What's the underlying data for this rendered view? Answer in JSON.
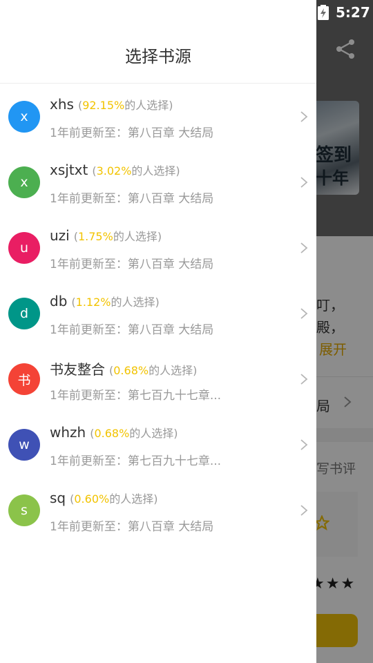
{
  "status_bar": {
    "time": "5:27",
    "battery_icon": "battery-charging-icon"
  },
  "background": {
    "share_icon": "share-icon",
    "cover_text_1": "签到",
    "cover_text_2": "十年",
    "intro_line_1": "叮，",
    "intro_line_2": "殿，",
    "expand_label": "展开",
    "row_label": "局",
    "review_label": "写书评",
    "accent_color": "#f0c20a"
  },
  "drawer": {
    "title": "选择书源",
    "sources": [
      {
        "avatar": "x",
        "color": "#2196f3",
        "name": "xhs",
        "percent": "92.15%",
        "suffix": "的人选择)",
        "prefix": "(",
        "update": "1年前更新至：第八百章 大结局"
      },
      {
        "avatar": "x",
        "color": "#4caf50",
        "name": "xsjtxt",
        "percent": "3.02%",
        "suffix": "的人选择)",
        "prefix": "(",
        "update": "1年前更新至：第八百章 大结局"
      },
      {
        "avatar": "u",
        "color": "#e91e63",
        "name": "uzi",
        "percent": "1.75%",
        "suffix": "的人选择)",
        "prefix": "(",
        "update": "1年前更新至：第八百章 大结局"
      },
      {
        "avatar": "d",
        "color": "#009688",
        "name": "db",
        "percent": "1.12%",
        "suffix": "的人选择)",
        "prefix": "(",
        "update": "1年前更新至：第八百章 大结局"
      },
      {
        "avatar": "书",
        "color": "#f44336",
        "name": "书友整合",
        "percent": "0.68%",
        "suffix": "的人选择)",
        "prefix": "(",
        "update": "1年前更新至：第七百九十七章..."
      },
      {
        "avatar": "w",
        "color": "#3f51b5",
        "name": "whzh",
        "percent": "0.68%",
        "suffix": "的人选择)",
        "prefix": "(",
        "update": "1年前更新至：第七百九十七章..."
      },
      {
        "avatar": "s",
        "color": "#8bc34a",
        "name": "sq",
        "percent": "0.60%",
        "suffix": "的人选择)",
        "prefix": "(",
        "update": "1年前更新至：第八百章 大结局"
      }
    ]
  }
}
